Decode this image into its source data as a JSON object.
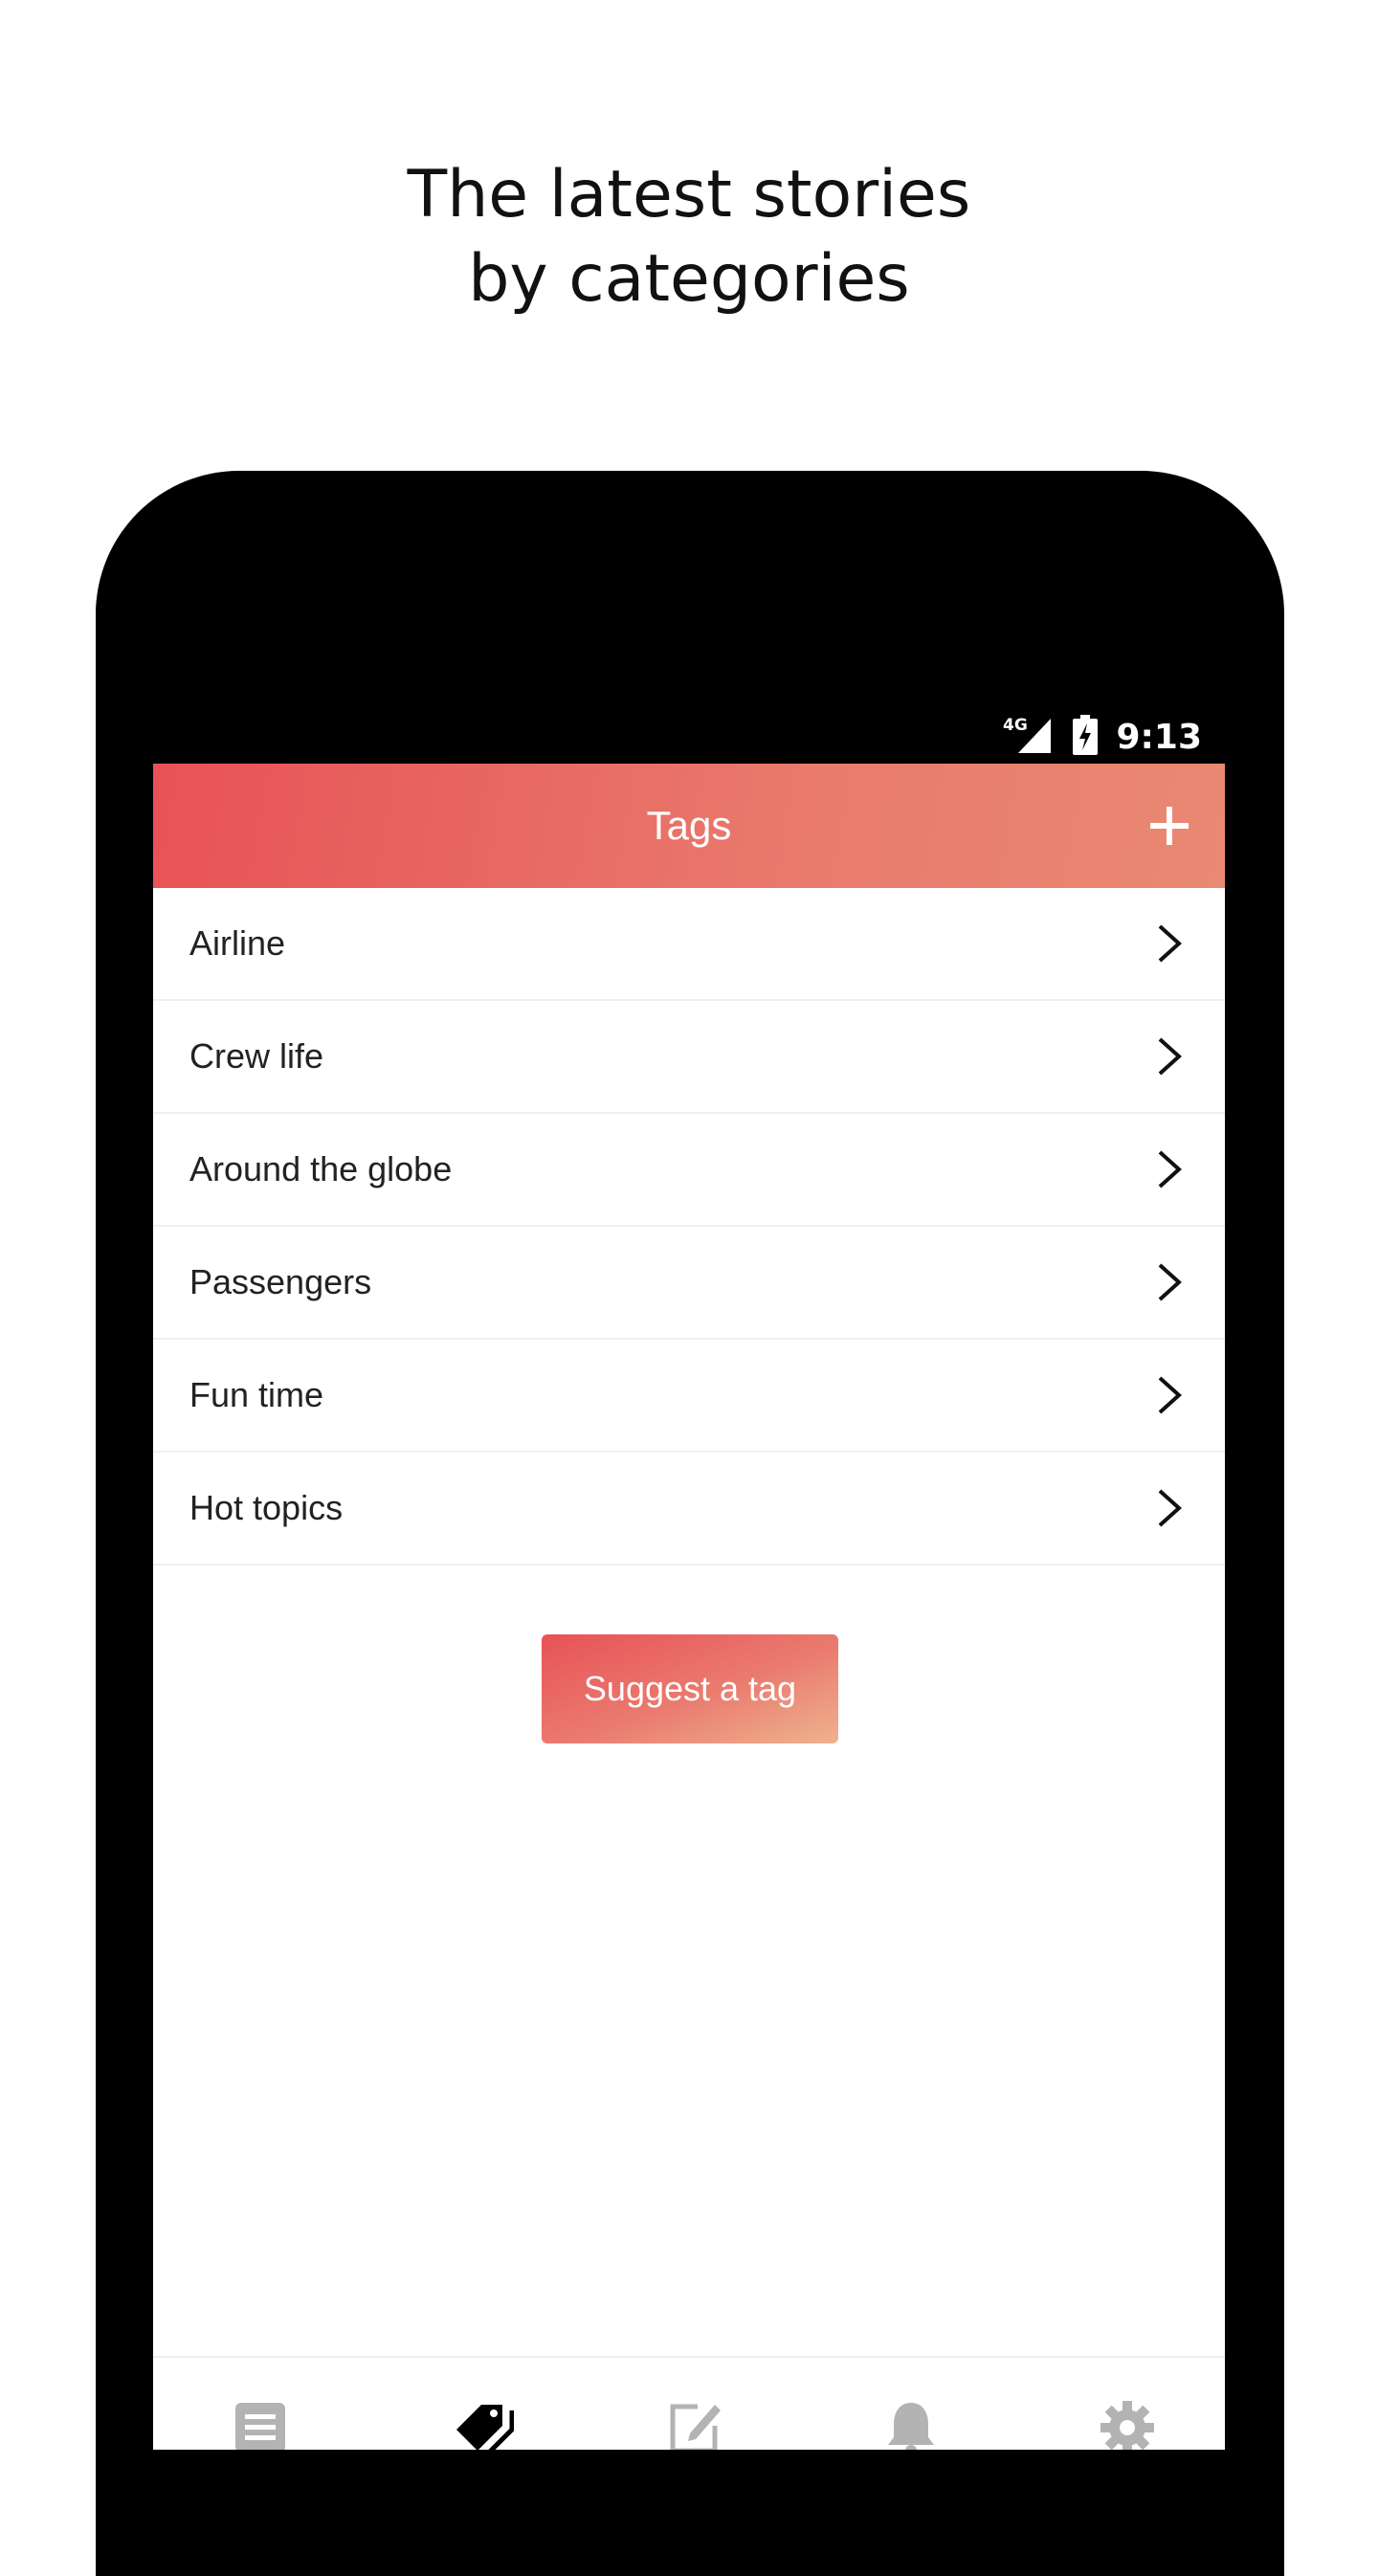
{
  "promo": {
    "headline_line1": "The latest stories",
    "headline_line2": "by categories"
  },
  "status_bar": {
    "network": "4G",
    "time": "9:13"
  },
  "app_bar": {
    "title": "Tags",
    "add_icon": "plus-icon"
  },
  "tags": [
    {
      "label": "Airline"
    },
    {
      "label": "Crew life"
    },
    {
      "label": "Around the globe"
    },
    {
      "label": "Passengers"
    },
    {
      "label": "Fun time"
    },
    {
      "label": "Hot topics"
    }
  ],
  "suggest_button": {
    "label": "Suggest a tag"
  },
  "bottom_nav": {
    "items": [
      {
        "icon": "feed-icon",
        "active": false
      },
      {
        "icon": "tags-icon",
        "active": true
      },
      {
        "icon": "compose-icon",
        "active": false
      },
      {
        "icon": "bell-icon",
        "active": false
      },
      {
        "icon": "gear-icon",
        "active": false
      }
    ]
  },
  "colors": {
    "accent_start": "#e85257",
    "accent_end": "#e98973",
    "nav_inactive": "#b3b3b3",
    "nav_active": "#000000"
  }
}
